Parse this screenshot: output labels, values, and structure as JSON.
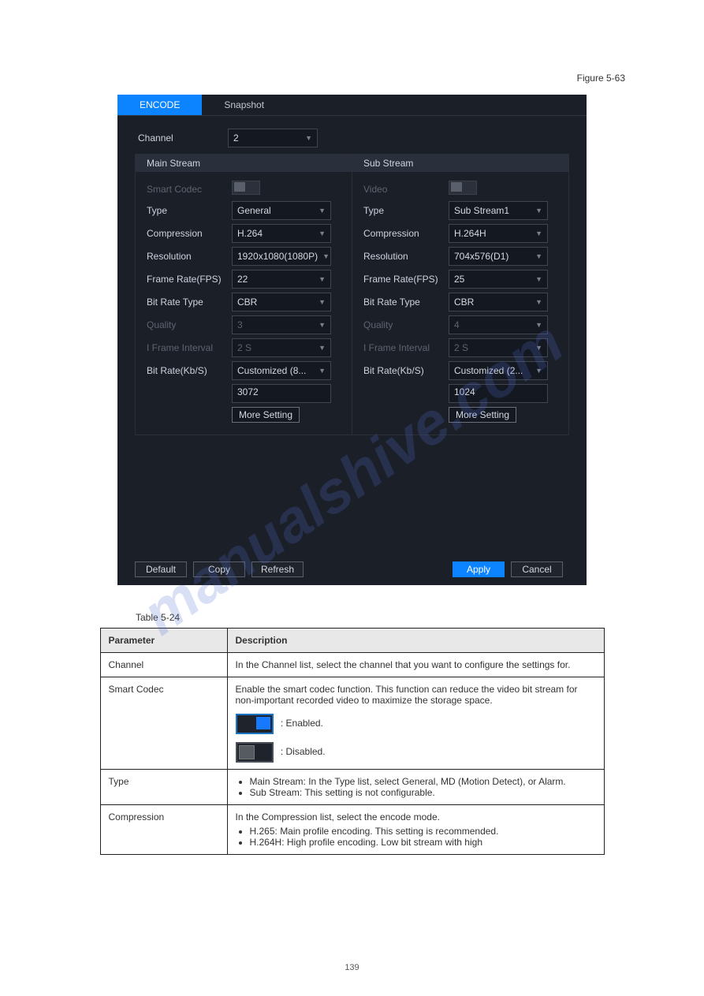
{
  "page_header": "Figure 5-63",
  "tabs": {
    "encode": "ENCODE",
    "snapshot": "Snapshot"
  },
  "channel": {
    "label": "Channel",
    "value": "2"
  },
  "main_stream_title": "Main Stream",
  "sub_stream_title": "Sub Stream",
  "rows": {
    "smart_codec": "Smart Codec",
    "video": "Video",
    "type": "Type",
    "compression": "Compression",
    "resolution": "Resolution",
    "frame_rate": "Frame Rate(FPS)",
    "bitrate_type": "Bit Rate Type",
    "quality": "Quality",
    "iframe": "I Frame Interval",
    "bitrate": "Bit Rate(Kb/S)"
  },
  "main": {
    "type": "General",
    "compression": "H.264",
    "resolution": "1920x1080(1080P)",
    "frame_rate": "22",
    "bitrate_type": "CBR",
    "quality": "3",
    "iframe": "2 S",
    "bitrate": "Customized (8...",
    "bitrate_value": "3072",
    "more": "More Setting"
  },
  "sub": {
    "type": "Sub Stream1",
    "compression": "H.264H",
    "resolution": "704x576(D1)",
    "frame_rate": "25",
    "bitrate_type": "CBR",
    "quality": "4",
    "iframe": "2 S",
    "bitrate": "Customized (2...",
    "bitrate_value": "1024",
    "more": "More Setting"
  },
  "buttons": {
    "default": "Default",
    "copy": "Copy",
    "refresh": "Refresh",
    "apply": "Apply",
    "cancel": "Cancel"
  },
  "table_caption": "Table 5-24",
  "table": {
    "h_param": "Parameter",
    "h_desc": "Description",
    "r_channel_p": "Channel",
    "r_channel_d": "In the Channel list, select the channel that you want to configure the settings for.",
    "r_smart_p": "Smart Codec",
    "r_smart_d1": "Enable the smart codec function. This function can reduce the video bit stream for non-important recorded video to maximize the storage space.",
    "r_smart_on": ": Enabled.",
    "r_smart_off": ": Disabled.",
    "r_type_p": "Type",
    "r_type_d1": "Main Stream: In the Type list, select General, MD (Motion Detect), or Alarm.",
    "r_type_d2": "Sub Stream: This setting is not configurable.",
    "r_comp_p": "Compression",
    "r_comp_d1": "In the Compression list, select the encode mode.",
    "r_comp_d2": "H.265: Main profile encoding. This setting is recommended.",
    "r_comp_d3": "H.264H: High profile encoding. Low bit stream with high"
  },
  "watermark": "manualshive.com",
  "pageno": "139"
}
